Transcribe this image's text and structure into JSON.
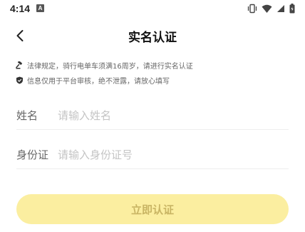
{
  "status_bar": {
    "time": "4:14",
    "notification_glyph": "A",
    "icons": [
      "vibrate-icon",
      "wifi-icon",
      "signal-icon",
      "battery-icon"
    ]
  },
  "nav": {
    "title": "实名认证",
    "back_icon": "chevron-left-icon"
  },
  "notices": [
    {
      "icon": "gavel-icon",
      "text": "法律规定，骑行电单车须满16周岁，请进行实名认证"
    },
    {
      "icon": "shield-icon",
      "text": "信息仅用于平台审核，绝不泄露，请放心填写"
    }
  ],
  "form": {
    "name": {
      "label": "姓名",
      "placeholder": "请输入姓名",
      "value": ""
    },
    "id_number": {
      "label": "身份证",
      "placeholder": "请输入身份证号",
      "value": ""
    }
  },
  "submit": {
    "label": "立即认证",
    "enabled": false
  },
  "colors": {
    "button_bg_disabled": "#fbeea0",
    "button_text_disabled": "#c9b564",
    "divider": "#eeeeee",
    "placeholder": "#c4c4c4"
  }
}
